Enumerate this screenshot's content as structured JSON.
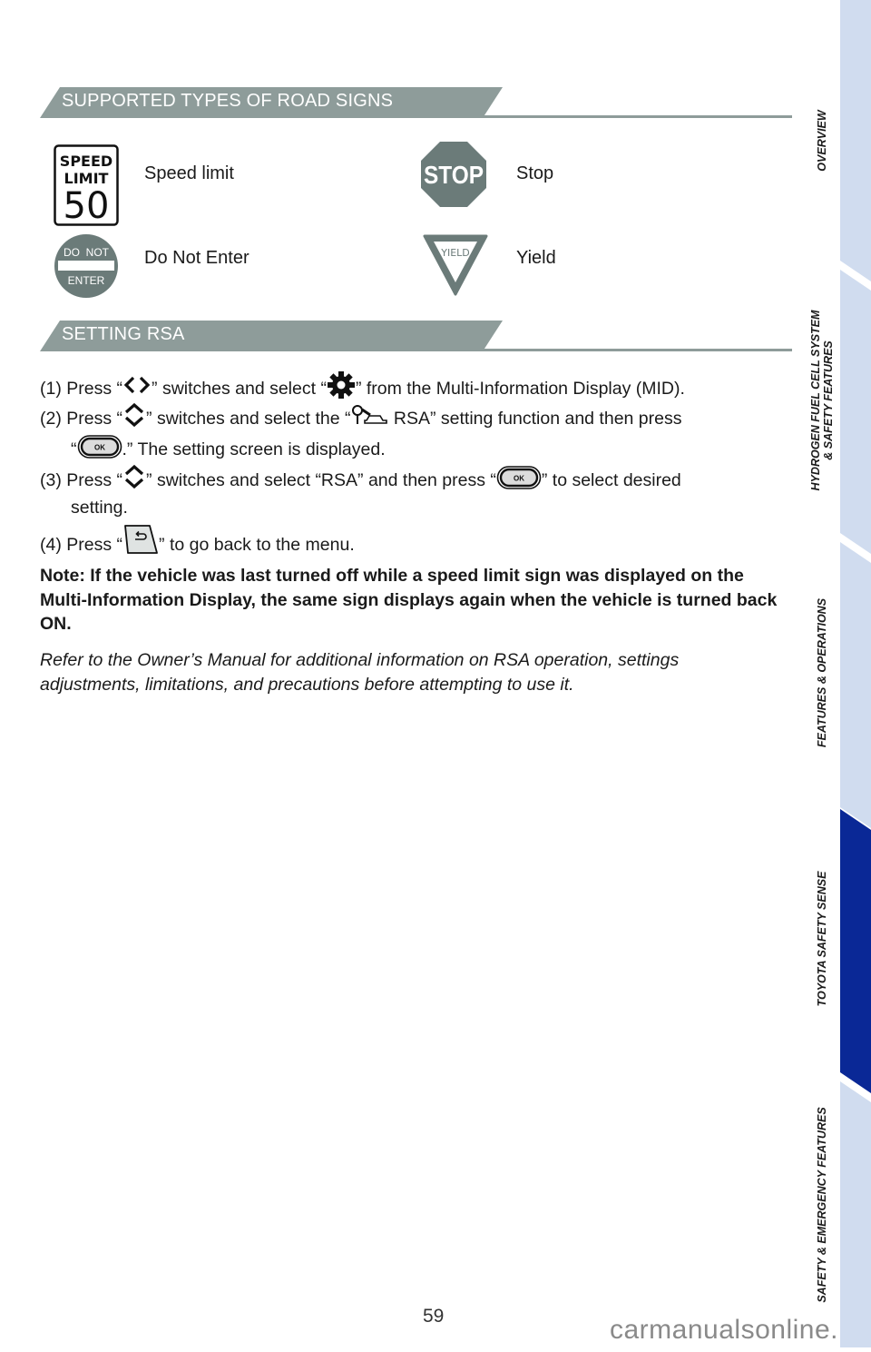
{
  "sections": {
    "road_signs": {
      "title": "SUPPORTED TYPES OF ROAD SIGNS",
      "signs": [
        {
          "label": "Speed limit",
          "icon": "speed-limit-sign-icon",
          "sign_text": [
            "SPEED",
            "LIMIT",
            "50"
          ]
        },
        {
          "label": "Stop",
          "icon": "stop-sign-icon",
          "sign_text": [
            "STOP"
          ]
        },
        {
          "label": "Do Not Enter",
          "icon": "do-not-enter-sign-icon",
          "sign_text": [
            "DO  NOT",
            "ENTER"
          ]
        },
        {
          "label": "Yield",
          "icon": "yield-sign-icon",
          "sign_text": [
            "YIELD"
          ]
        }
      ]
    },
    "setting_rsa": {
      "title": "SETTING RSA",
      "steps": [
        {
          "num": "(1)",
          "parts": [
            "Press “",
            "” switches and select “",
            "” from the Multi-Information Display (MID)."
          ],
          "icons": [
            "left-right-arrows-icon",
            "gear-icon"
          ]
        },
        {
          "num": "(2)",
          "parts": [
            "Press “",
            "” switches and select the “",
            " RSA” setting function and then press"
          ],
          "continuation": [
            "“",
            ".” The setting screen is displayed."
          ],
          "icons": [
            "up-down-arrows-icon",
            "rsa-icon",
            "ok-button-icon"
          ]
        },
        {
          "num": "(3)",
          "parts": [
            "Press “",
            "” switches and select “RSA” and then press “",
            "” to select desired"
          ],
          "continuation": [
            "setting."
          ],
          "icons": [
            "up-down-arrows-icon",
            "ok-button-icon"
          ]
        },
        {
          "num": "(4)",
          "parts": [
            "Press “",
            "” to go back to the menu."
          ],
          "icons": [
            "back-button-icon"
          ]
        }
      ],
      "ok_label": "OK",
      "note": "Note: If the vehicle was last turned off while a speed limit sign was displayed on the Multi-Information Display, the same sign displays again when the vehicle is turned back ON.",
      "refer": "Refer to the Owner’s Manual for additional information on RSA operation, settings adjustments, limitations, and precautions before attempting to use it."
    }
  },
  "sidebar": {
    "tabs": [
      {
        "label": "OVERVIEW",
        "active": false
      },
      {
        "label": "HYDROGEN FUEL CELL SYSTEM",
        "label2": "& SAFETY FEATURES",
        "active": false
      },
      {
        "label": "FEATURES & OPERATIONS",
        "active": false
      },
      {
        "label": "TOYOTA SAFETY SENSE",
        "active": true
      },
      {
        "label": "SAFETY & EMERGENCY FEATURES",
        "active": false
      }
    ]
  },
  "footer": {
    "page_number": "59",
    "watermark": "carmanualsonline.info"
  },
  "colors": {
    "banner": "#8e9c9a",
    "sign_gray": "#6b7b79",
    "tab_inactive": "#d0dcef",
    "tab_active": "#0a2896"
  }
}
